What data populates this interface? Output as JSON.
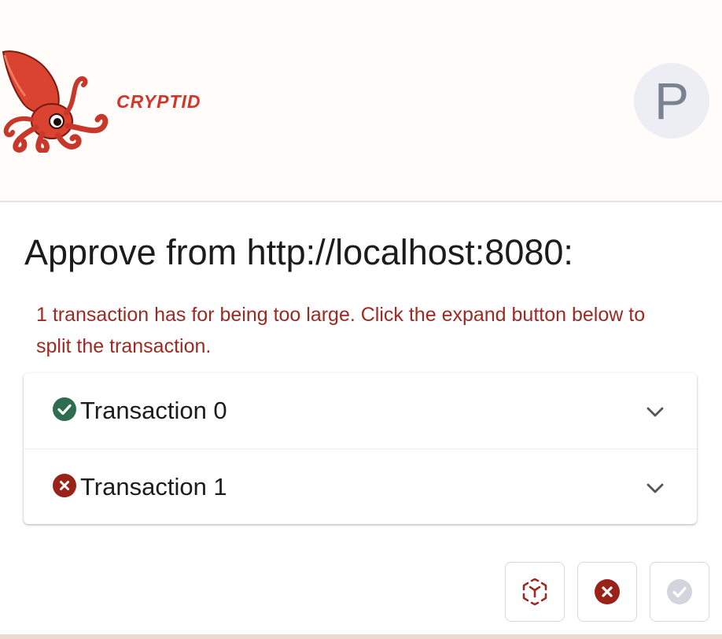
{
  "header": {
    "brand": "CRYPTID",
    "avatar_letter": "P"
  },
  "main": {
    "title": "Approve from http://localhost:8080:",
    "error_message": "1 transaction has for being too large. Click the expand button below to split the transaction."
  },
  "transactions": [
    {
      "label": "Transaction 0",
      "status": "ok"
    },
    {
      "label": "Transaction 1",
      "status": "error"
    }
  ],
  "icons": {
    "ok": "check-circle-icon",
    "error": "x-circle-icon",
    "expand": "chevron-down-icon",
    "split": "cube-split-icon",
    "reject": "cancel-circle-icon",
    "approve": "approve-check-circle-icon"
  },
  "colors": {
    "brand_red": "#d4342a",
    "error_text": "#9b2a22",
    "ok_green": "#2e6b4f",
    "error_red": "#992219",
    "disabled_grey": "#d2d6dc",
    "avatar_bg": "#eceef3"
  }
}
